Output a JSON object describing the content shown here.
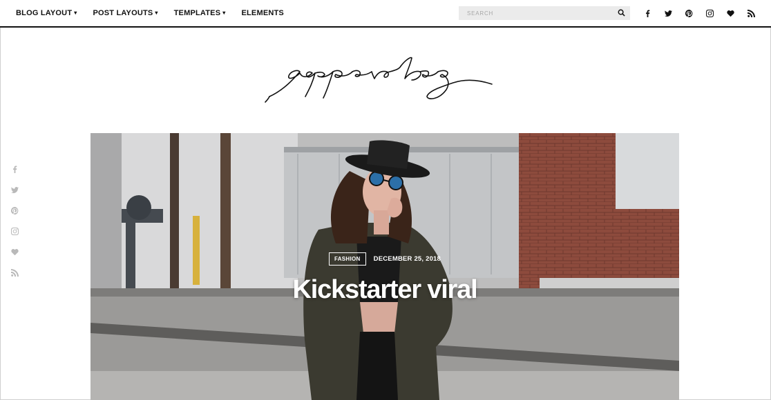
{
  "nav": {
    "items": [
      {
        "label": "BLOG LAYOUT",
        "has_dropdown": true
      },
      {
        "label": "POST LAYOUTS",
        "has_dropdown": true
      },
      {
        "label": "TEMPLATES",
        "has_dropdown": true
      },
      {
        "label": "ELEMENTS",
        "has_dropdown": false
      }
    ],
    "chevron": "⌄"
  },
  "search": {
    "placeholder": "SEARCH",
    "icon": "search-icon"
  },
  "social_icons": [
    "facebook-icon",
    "twitter-icon",
    "pinterest-icon",
    "instagram-icon",
    "heart-icon",
    "rss-icon"
  ],
  "logo": {
    "text": "paperbag"
  },
  "side_share_icons": [
    "facebook-icon",
    "twitter-icon",
    "pinterest-icon",
    "instagram-icon",
    "heart-icon",
    "rss-icon"
  ],
  "hero": {
    "category": "FASHION",
    "date": "DECEMBER 25, 2018",
    "title": "Kickstarter viral"
  },
  "colors": {
    "nav_text": "#111111",
    "side_icons": "#b9b9b9",
    "search_bg": "#ebebeb"
  }
}
